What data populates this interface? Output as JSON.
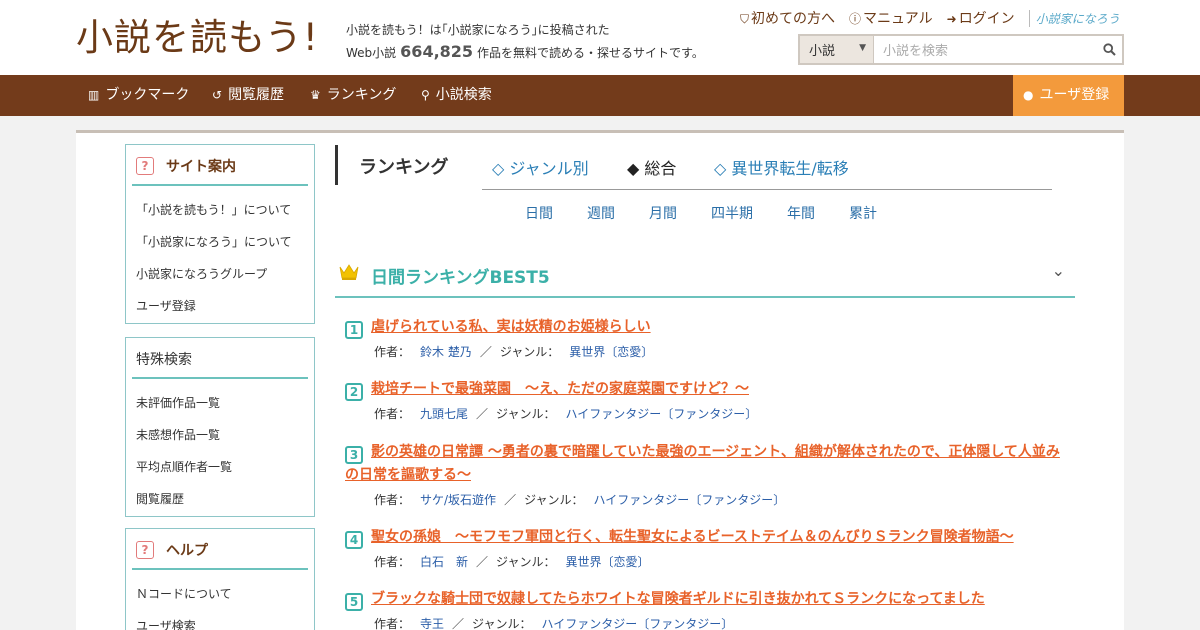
{
  "header": {
    "logo_text": "小説を読もう!",
    "tagline_line1": "小説を読もう！は｢小説家になろう｣に投稿された",
    "tagline_prefix": "Web小説",
    "work_count": "664,825",
    "tagline_suffix": "作品を無料で読める・探せるサイトです。",
    "toplinks": [
      {
        "label": "初めての方へ",
        "icon": "shield-icon"
      },
      {
        "label": "マニュアル",
        "icon": "help-circle-icon"
      },
      {
        "label": "ログイン",
        "icon": "login-icon"
      }
    ],
    "partner_logo": "小説家になろう",
    "search": {
      "select_value": "小説",
      "placeholder": "小説を検索"
    }
  },
  "nav": {
    "items": [
      {
        "label": "ブックマーク",
        "icon": "bookshelf-icon"
      },
      {
        "label": "閲覧履歴",
        "icon": "history-icon"
      },
      {
        "label": "ランキング",
        "icon": "crown-icon"
      },
      {
        "label": "小説検索",
        "icon": "search-icon"
      }
    ],
    "register_label": "ユーザ登録",
    "register_icon": "user-icon"
  },
  "sidebar": {
    "site_guide": {
      "title": "サイト案内",
      "items": [
        "「小説を読もう！」について",
        "「小説家になろう」について",
        "小説家になろうグループ",
        "ユーザ登録"
      ]
    },
    "special_search": {
      "title": "特殊検索",
      "items": [
        "未評価作品一覧",
        "未感想作品一覧",
        "平均点順作者一覧",
        "閲覧履歴"
      ]
    },
    "help": {
      "title": "ヘルプ",
      "items": [
        "Ｎコードについて",
        "ユーザ検索"
      ]
    }
  },
  "ranking": {
    "title": "ランキング",
    "tabs": [
      {
        "label": "◇ ジャンル別",
        "active": false
      },
      {
        "label": "◆ 総合",
        "active": true
      },
      {
        "label": "◇ 異世界転生/転移",
        "active": false
      }
    ],
    "periods": [
      "日間",
      "週間",
      "月間",
      "四半期",
      "年間",
      "累計"
    ],
    "best_title": "日間ランキングBEST5",
    "author_label": "作者：",
    "genre_label": "ジャンル：",
    "entries": [
      {
        "rank": "1",
        "title": "虐げられている私、実は妖精のお姫様らしい",
        "author": "鈴木 楚乃",
        "genre": "異世界〔恋愛〕"
      },
      {
        "rank": "2",
        "title": "栽培チートで最強菜園　～え、ただの家庭菜園ですけど？～",
        "author": "九頭七尾",
        "genre": "ハイファンタジー〔ファンタジー〕"
      },
      {
        "rank": "3",
        "title": "影の英雄の日常譚 ～勇者の裏で暗躍していた最強のエージェント、組織が解体されたので、正体隠して人並みの日常を謳歌する～",
        "author": "サケ/坂石遊作",
        "genre": "ハイファンタジー〔ファンタジー〕"
      },
      {
        "rank": "4",
        "title": "聖女の孫娘　～モフモフ軍団と行く、転生聖女によるビーストテイム＆のんびりＳランク冒険者物語～",
        "author": "白石　新",
        "genre": "異世界〔恋愛〕"
      },
      {
        "rank": "5",
        "title": "ブラックな騎士団で奴隷してたらホワイトな冒険者ギルドに引き抜かれてＳランクになってました",
        "author": "寺王",
        "genre": "ハイファンタジー〔ファンタジー〕"
      }
    ]
  },
  "colors": {
    "brand_brown": "#733b1b",
    "register_orange": "#f39a3c",
    "teal_accent": "#3bb0a8",
    "title_orange": "#e8622a",
    "link_blue": "#2b7fb6"
  }
}
